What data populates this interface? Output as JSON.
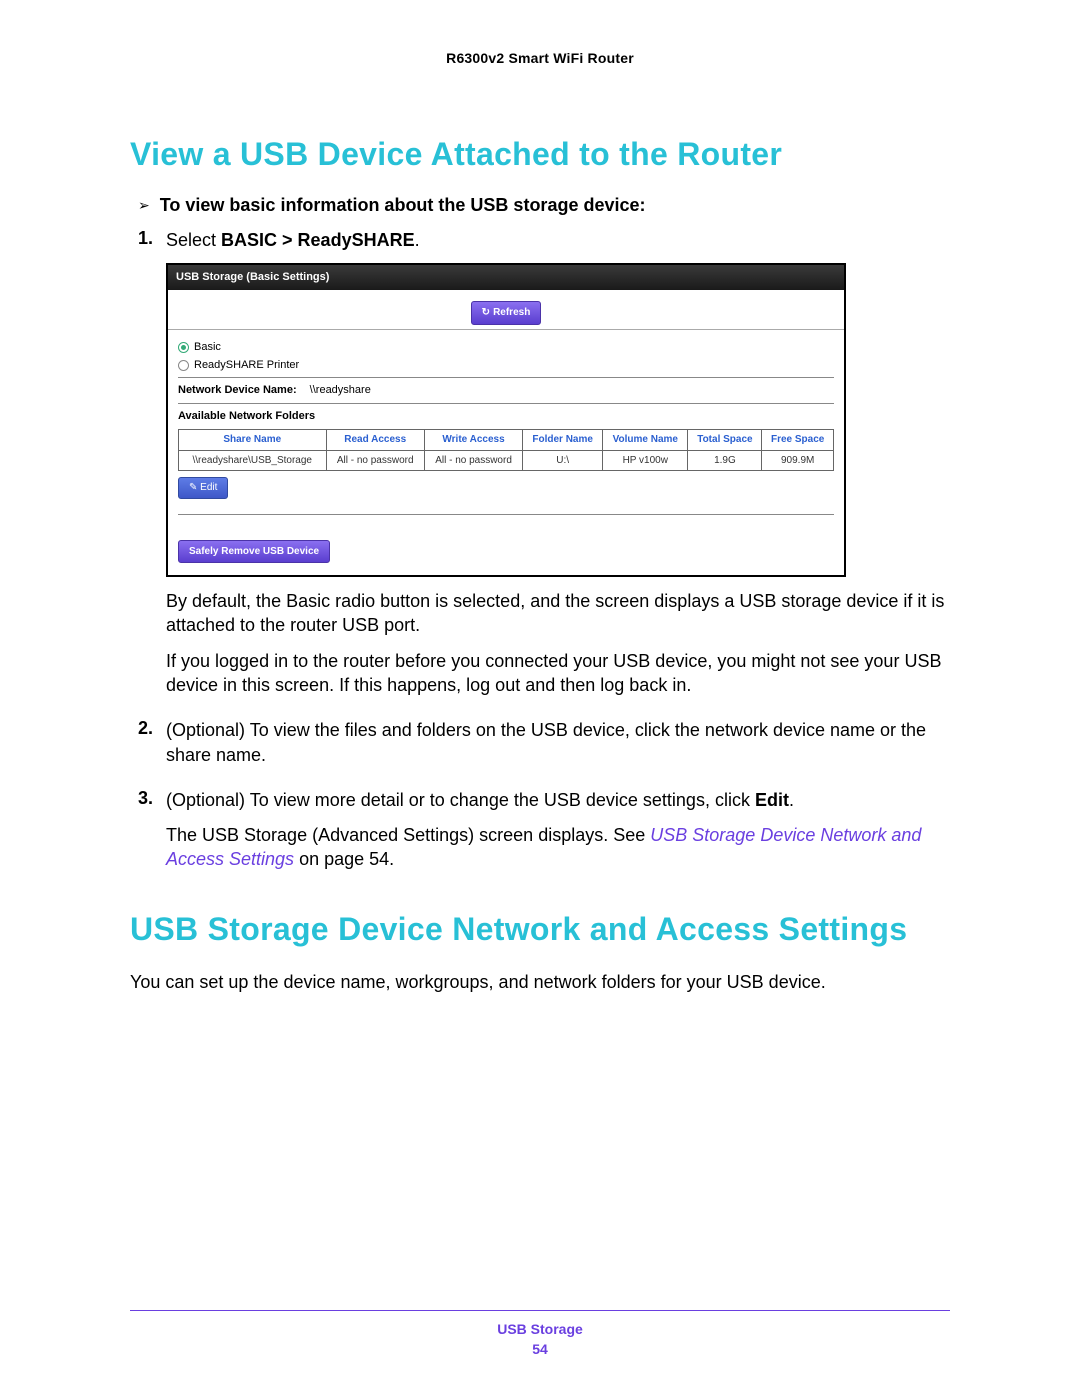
{
  "doc": {
    "header": "R6300v2 Smart WiFi Router",
    "h1": "View a USB Device Attached to the Router",
    "arrowLine": "To view basic information about the USB storage device:",
    "step1_pre": "Select ",
    "step1_bold": "BASIC > ReadySHARE",
    "step1_post": ".",
    "belowShot1": "By default, the Basic radio button is selected, and the screen displays a USB storage device if it is attached to the router USB port.",
    "belowShot2": "If you logged in to the router before you connected your USB device, you might not see your USB device in this screen. If this happens, log out and then log back in.",
    "step2": "(Optional) To view the files and folders on the USB device, click the network device name or the share name.",
    "step3_pre": "(Optional) To view more detail or to change the USB device settings, click ",
    "step3_bold": "Edit",
    "step3_post": ".",
    "step3_p2_pre": "The USB Storage (Advanced Settings) screen displays. See ",
    "step3_p2_link": "USB Storage Device Network and Access Settings",
    "step3_p2_post": " on page 54.",
    "h2": "USB Storage Device Network and Access Settings",
    "h2_sub": "You can set up the device name, workgroups, and network folders for your USB device.",
    "footerTitle": "USB Storage",
    "footerPage": "54"
  },
  "ui": {
    "title": "USB Storage (Basic Settings)",
    "refresh": "Refresh",
    "radio1": "Basic",
    "radio2": "ReadySHARE Printer",
    "ndLabel": "Network Device Name:",
    "ndValue": "\\\\readyshare",
    "availLabel": "Available Network Folders",
    "headers": [
      "Share Name",
      "Read Access",
      "Write Access",
      "Folder Name",
      "Volume Name",
      "Total Space",
      "Free Space"
    ],
    "row": [
      "\\\\readyshare\\USB_Storage",
      "All - no password",
      "All - no password",
      "U:\\",
      "HP v100w",
      "1.9G",
      "909.9M"
    ],
    "editBtn": "Edit",
    "removeBtn": "Safely Remove USB Device"
  }
}
